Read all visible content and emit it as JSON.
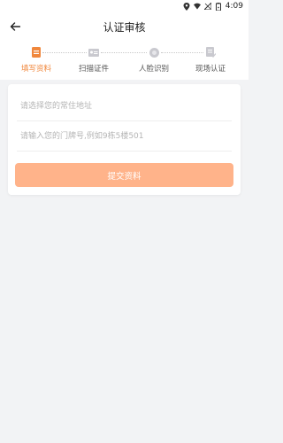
{
  "statusbar": {
    "time": "4:09"
  },
  "header": {
    "title": "认证审核"
  },
  "steps": [
    {
      "label": "填写资料",
      "active": true
    },
    {
      "label": "扫描证件",
      "active": false
    },
    {
      "label": "人脸识别",
      "active": false
    },
    {
      "label": "现场认证",
      "active": false
    }
  ],
  "form": {
    "address_placeholder": "请选择您的常住地址",
    "address_value": "",
    "door_placeholder": "请输入您的门牌号,例如9栋5楼501",
    "door_value": "",
    "submit_label": "提交资料"
  },
  "colors": {
    "accent": "#f0873c",
    "button": "#ffb38a",
    "background": "#f2f3f5"
  }
}
